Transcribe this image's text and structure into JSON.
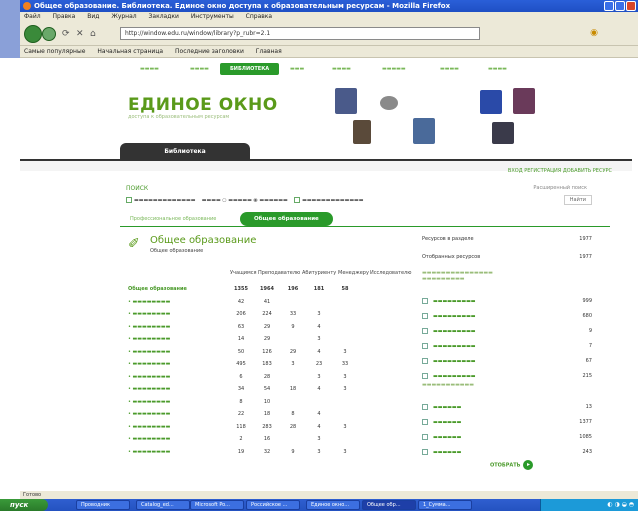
{
  "window": {
    "title": "Общее образование. Библиотека. Единое окно доступа к образовательным ресурсам - Mozilla Firefox"
  },
  "menu": [
    "Файл",
    "Правка",
    "Вид",
    "Журнал",
    "Закладки",
    "Инструменты",
    "Справка"
  ],
  "nav": {
    "url": "http://window.edu.ru/window/library?p_rubr=2.1"
  },
  "bookmarks": [
    "Самые популярные",
    "Начальная страница",
    "Последние заголовки",
    "Главная"
  ],
  "site": {
    "topnav_active": "БИБЛИОТЕКА",
    "logo": "ЕДИНОЕ ОКНО",
    "logo_sub": "доступа к образовательным ресурсам",
    "tab": "Библиотека",
    "toplinks": "ВХОД   РЕГИСТРАЦИЯ   ДОБАВИТЬ РЕСУРС",
    "search_label": "ПОИСК",
    "advanced": "Расширенный поиск",
    "find_button": "Найти",
    "tab_pro": "Профессиональное образование",
    "tab_general": "Общее образование",
    "section_title": "Общее образование",
    "section_sub": "Общее образование"
  },
  "table": {
    "columns": [
      "Учащимся",
      "Преподавателю",
      "Абитуриенту",
      "Менеджеру",
      "Исследователю"
    ],
    "header_row": {
      "name": "Общее образование",
      "values": [
        "1355",
        "1964",
        "196",
        "181",
        "58"
      ]
    },
    "rows": [
      {
        "values": [
          "42",
          "41",
          "",
          "",
          ""
        ]
      },
      {
        "values": [
          "206",
          "224",
          "33",
          "3",
          ""
        ]
      },
      {
        "values": [
          "63",
          "29",
          "9",
          "4",
          ""
        ]
      },
      {
        "values": [
          "14",
          "29",
          "",
          "3",
          ""
        ]
      },
      {
        "values": [
          "50",
          "126",
          "29",
          "4",
          "3"
        ]
      },
      {
        "values": [
          "495",
          "183",
          "3",
          "23",
          "33"
        ]
      },
      {
        "values": [
          "6",
          "28",
          "",
          "3",
          "3"
        ]
      },
      {
        "values": [
          "34",
          "54",
          "18",
          "4",
          "3"
        ]
      },
      {
        "values": [
          "8",
          "10",
          "",
          "",
          ""
        ]
      },
      {
        "values": [
          "22",
          "18",
          "8",
          "4",
          ""
        ]
      },
      {
        "values": [
          "118",
          "283",
          "28",
          "4",
          "3"
        ]
      },
      {
        "values": [
          "2",
          "16",
          "",
          "3",
          ""
        ]
      },
      {
        "values": [
          "19",
          "32",
          "9",
          "3",
          "3"
        ]
      }
    ]
  },
  "right": {
    "stat1_label": "Ресурсов в разделе",
    "stat1_value": "1977",
    "stat2_label": "Отобранных ресурсов",
    "stat2_value": "1977",
    "types": [
      {
        "value": "999"
      },
      {
        "value": "680"
      },
      {
        "value": "9"
      },
      {
        "value": "7"
      },
      {
        "value": "67"
      },
      {
        "value": "215"
      }
    ],
    "levels": [
      {
        "value": "13"
      },
      {
        "value": "1377"
      },
      {
        "value": "1085"
      },
      {
        "value": "243"
      }
    ],
    "show_button": "ОТОБРАТЬ"
  },
  "statusbar": "Готово",
  "taskbar": {
    "start": "пуск",
    "tasks": [
      "Проводник",
      "Catalog_ed...",
      "Microsoft Po...",
      "Российское ...",
      "Единое окно...",
      "Общее обр...",
      "1_Сумма..."
    ]
  }
}
